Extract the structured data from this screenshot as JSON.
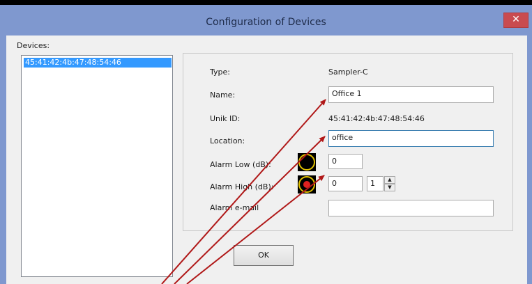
{
  "window": {
    "title": "Configuration of Devices",
    "close_symbol": "✕"
  },
  "devices": {
    "label": "Devices:",
    "items": [
      "45:41:42:4b:47:48:54:46"
    ],
    "selected_index": 0
  },
  "details": {
    "type_label": "Type:",
    "type_value": "Sampler-C",
    "name_label": "Name:",
    "name_value": "Office 1",
    "unik_id_label": "Unik ID:",
    "unik_id_value": "45:41:42:4b:47:48:54:46",
    "location_label": "Location:",
    "location_value": "office",
    "alarm_low_label": "Alarm Low (dB):",
    "alarm_low_value": "0",
    "alarm_high_label": "Alarm High (dB):",
    "alarm_high_value": "0",
    "alarm_high_step": "1",
    "alarm_email_label": "Alarm e-mail",
    "alarm_email_value": ""
  },
  "buttons": {
    "ok_label": "OK"
  },
  "icons": {
    "close": "close-icon",
    "alarm_low": "alarm-low-indicator-icon",
    "alarm_high": "alarm-high-indicator-icon",
    "spin_up": "spin-up-icon",
    "spin_down": "spin-down-icon"
  },
  "colors": {
    "titlebar": "#7f98cf",
    "close_button": "#c94b4f",
    "selection": "#3399ff",
    "annotation_arrow": "#b01818",
    "indicator_ring": "#e0c000",
    "indicator_dot": "#e02020"
  }
}
